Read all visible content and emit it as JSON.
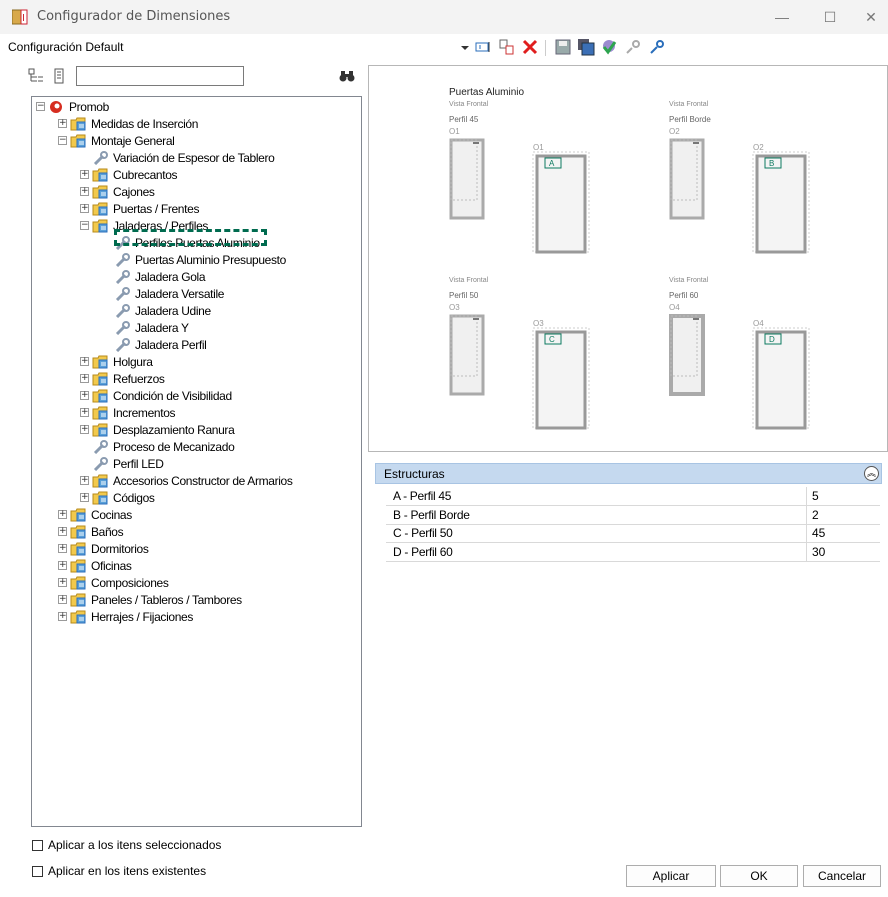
{
  "window": {
    "title": "Configurador de Dimensiones",
    "minimize": "—",
    "maximize": "☐",
    "close": "✕"
  },
  "header": {
    "config_label": "Configuración Default"
  },
  "search": {
    "value": ""
  },
  "tree": [
    {
      "label": "Promob",
      "level": 0,
      "expander": "−",
      "icon": "promob-logo-icon"
    },
    {
      "label": "Medidas de Inserción",
      "level": 1,
      "expander": "+",
      "icon": "folder-icon"
    },
    {
      "label": "Montaje General",
      "level": 1,
      "expander": "−",
      "icon": "folder-icon"
    },
    {
      "label": "Variación de Espesor de Tablero",
      "level": 2,
      "expander": "",
      "icon": "wrench-icon"
    },
    {
      "label": "Cubrecantos",
      "level": 2,
      "expander": "+",
      "icon": "folder-icon"
    },
    {
      "label": "Cajones",
      "level": 2,
      "expander": "+",
      "icon": "folder-icon"
    },
    {
      "label": "Puertas / Frentes",
      "level": 2,
      "expander": "+",
      "icon": "folder-icon"
    },
    {
      "label": "Jaladeras / Perfiles",
      "level": 2,
      "expander": "−",
      "icon": "folder-icon"
    },
    {
      "label": "Perfiles Puertas Aluminio",
      "level": 3,
      "expander": "",
      "icon": "wrench-icon",
      "selected": true
    },
    {
      "label": "Puertas Aluminio Presupuesto",
      "level": 3,
      "expander": "",
      "icon": "wrench-icon"
    },
    {
      "label": "Jaladera Gola",
      "level": 3,
      "expander": "",
      "icon": "wrench-icon"
    },
    {
      "label": "Jaladera Versatile",
      "level": 3,
      "expander": "",
      "icon": "wrench-icon"
    },
    {
      "label": "Jaladera Udine",
      "level": 3,
      "expander": "",
      "icon": "wrench-icon"
    },
    {
      "label": "Jaladera Y",
      "level": 3,
      "expander": "",
      "icon": "wrench-icon"
    },
    {
      "label": "Jaladera Perfil",
      "level": 3,
      "expander": "",
      "icon": "wrench-icon"
    },
    {
      "label": "Holgura",
      "level": 2,
      "expander": "+",
      "icon": "folder-icon"
    },
    {
      "label": "Refuerzos",
      "level": 2,
      "expander": "+",
      "icon": "folder-icon"
    },
    {
      "label": "Condición de Visibilidad",
      "level": 2,
      "expander": "+",
      "icon": "folder-icon"
    },
    {
      "label": "Incrementos",
      "level": 2,
      "expander": "+",
      "icon": "folder-icon"
    },
    {
      "label": "Desplazamiento Ranura",
      "level": 2,
      "expander": "+",
      "icon": "folder-icon"
    },
    {
      "label": "Proceso de Mecanizado",
      "level": 2,
      "expander": "",
      "icon": "wrench-icon"
    },
    {
      "label": "Perfil LED",
      "level": 2,
      "expander": "",
      "icon": "wrench-icon"
    },
    {
      "label": "Accesorios Constructor de Armarios",
      "level": 2,
      "expander": "+",
      "icon": "folder-icon"
    },
    {
      "label": "Códigos",
      "level": 2,
      "expander": "+",
      "icon": "folder-icon"
    },
    {
      "label": "Cocinas",
      "level": 1,
      "expander": "+",
      "icon": "folder-icon"
    },
    {
      "label": "Baños",
      "level": 1,
      "expander": "+",
      "icon": "folder-icon"
    },
    {
      "label": "Dormitorios",
      "level": 1,
      "expander": "+",
      "icon": "folder-icon"
    },
    {
      "label": "Oficinas",
      "level": 1,
      "expander": "+",
      "icon": "folder-icon"
    },
    {
      "label": "Composiciones",
      "level": 1,
      "expander": "+",
      "icon": "folder-icon"
    },
    {
      "label": "Paneles / Tableros / Tambores",
      "level": 1,
      "expander": "+",
      "icon": "folder-icon"
    },
    {
      "label": "Herrajes / Fijaciones",
      "level": 1,
      "expander": "+",
      "icon": "folder-icon"
    }
  ],
  "preview": {
    "title": "Puertas Aluminio",
    "panels": [
      {
        "view": "Vista Frontal",
        "profile": "Perfil 45",
        "door_code": "O1",
        "detail_code": "O1",
        "marker": "A"
      },
      {
        "view": "Vista Frontal",
        "profile": "Perfil Borde",
        "door_code": "O2",
        "detail_code": "O2",
        "marker": "B"
      },
      {
        "view": "Vista Frontal",
        "profile": "Perfil 50",
        "door_code": "O3",
        "detail_code": "O3",
        "marker": "C"
      },
      {
        "view": "Vista Frontal",
        "profile": "Perfil 60",
        "door_code": "O4",
        "detail_code": "O4",
        "marker": "D"
      }
    ]
  },
  "properties": {
    "section_title": "Estructuras",
    "rows": [
      {
        "name": "A - Perfil 45",
        "value": "5"
      },
      {
        "name": "B - Perfil Borde",
        "value": "2"
      },
      {
        "name": "C - Perfil 50",
        "value": "45"
      },
      {
        "name": "D - Perfil 60",
        "value": "30"
      }
    ]
  },
  "options": {
    "apply_selected": "Aplicar a los itens seleccionados",
    "apply_existing": "Aplicar en los itens existentes"
  },
  "buttons": {
    "apply": "Aplicar",
    "ok": "OK",
    "cancel": "Cancelar"
  },
  "colors": {
    "selection_highlight": "#006b4f",
    "section_header": "#c5d9ef",
    "folder": "#f2c94c",
    "delete": "#e01e1e"
  }
}
